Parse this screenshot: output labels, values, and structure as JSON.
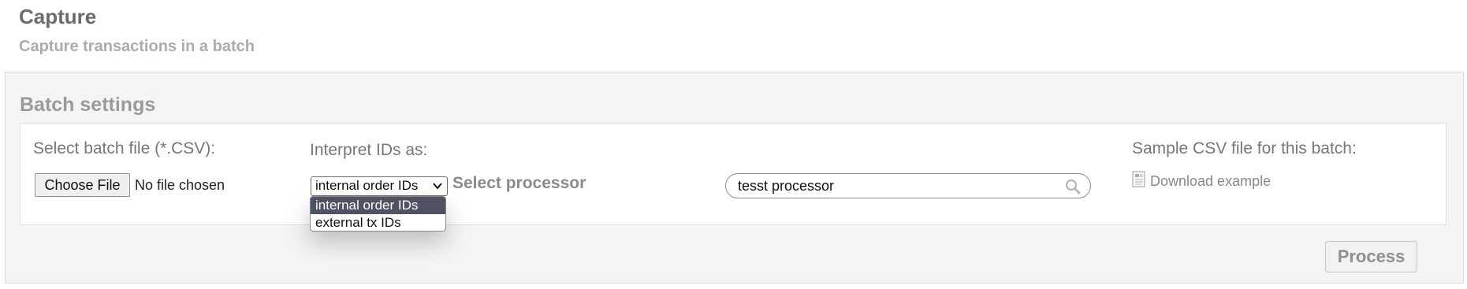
{
  "page": {
    "title": "Capture",
    "subtitle": "Capture transactions in a batch"
  },
  "batch_settings": {
    "title": "Batch settings",
    "file": {
      "label": "Select batch file (*.CSV):",
      "button_label": "Choose File",
      "status": "No file chosen"
    },
    "interpret": {
      "label": "Interpret IDs as:",
      "selected": "internal order IDs",
      "options": [
        "internal order IDs",
        "external tx IDs"
      ]
    },
    "processor": {
      "label": "Select processor",
      "search_value": "tesst processor"
    },
    "sample": {
      "label": "Sample CSV file for this batch:",
      "link_text": "Download example"
    },
    "process_button": "Process"
  },
  "icons": {
    "dropdown": "chevron-down-icon",
    "search": "search-icon",
    "document": "document-icon"
  },
  "colors": {
    "dropdown_selected": "#4f5263",
    "panel_background": "#f4f4f4"
  }
}
